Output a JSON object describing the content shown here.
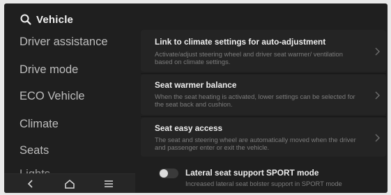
{
  "header": {
    "title": "Vehicle",
    "icon": "search-icon"
  },
  "sidebar": {
    "items": [
      {
        "label": "Driver assistance"
      },
      {
        "label": "Drive mode"
      },
      {
        "label": "ECO Vehicle"
      },
      {
        "label": "Climate"
      },
      {
        "label": "Seats"
      },
      {
        "label": "Lights"
      }
    ]
  },
  "bottom_nav": {
    "icons": [
      "back-icon",
      "home-icon",
      "menu-icon"
    ]
  },
  "settings": {
    "climate_link": {
      "title": "Link to climate settings for auto-adjustment",
      "desc": "Activate/adjust steering wheel and driver seat warmer/ ventilation based on climate settings."
    },
    "warmer_balance": {
      "title": "Seat warmer balance",
      "desc": "When the seat heating is activated, lower settings can be selected for the seat back and cushion."
    },
    "easy_access": {
      "title": "Seat easy access",
      "desc": "The seat and steering wheel are automatically moved when the driver and passenger enter or exit the vehicle."
    },
    "lateral_support": {
      "title": "Lateral seat support SPORT mode",
      "desc": "Increased lateral seat bolster support in SPORT mode",
      "enabled": false
    }
  },
  "colors": {
    "background": "#1f1f1f",
    "row": "#242424",
    "text_primary": "#eeeeee",
    "text_secondary": "#7d7d7d",
    "sidebar_text": "#bdbdbd"
  }
}
